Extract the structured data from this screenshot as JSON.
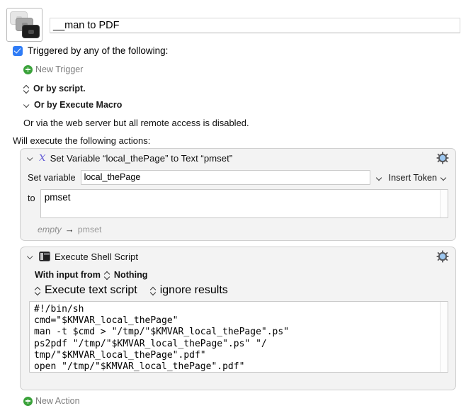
{
  "header": {
    "icon_name": "macro-stack-icon",
    "macro_title": "__man to PDF"
  },
  "triggers": {
    "checkbox_checked": true,
    "label": "Triggered by any of the following:",
    "new_trigger_label": "New Trigger",
    "or_by_script_label": "Or by script.",
    "or_by_execute_macro_label": "Or by Execute Macro",
    "web_server_note": "Or via the web server but all remote access is disabled."
  },
  "actions_intro": "Will execute the following actions:",
  "actions": [
    {
      "title": "Set Variable “local_thePage” to Text “pmset”",
      "icon_name": "variable-x-icon",
      "set_variable_label": "Set variable",
      "variable_name": "local_thePage",
      "insert_token_label": "Insert Token",
      "to_label": "to",
      "to_value": "pmset",
      "result_from": "empty",
      "result_arrow": "→",
      "result_to": "pmset"
    },
    {
      "title": "Execute Shell Script",
      "icon_name": "terminal-icon",
      "with_input_from_label": "With input from",
      "input_source": "Nothing",
      "execute_mode": "Execute text script",
      "results_mode": "ignore results",
      "script": "#!/bin/sh\ncmd=\"$KMVAR_local_thePage\"\nman -t $cmd > \"/tmp/\"$KMVAR_local_thePage\".ps\"\nps2pdf \"/tmp/\"$KMVAR_local_thePage\".ps\" \"/\ntmp/\"$KMVAR_local_thePage\".pdf\"\nopen \"/tmp/\"$KMVAR_local_thePage\".pdf\""
    }
  ],
  "new_action_label": "New Action",
  "colors": {
    "checkbox_blue": "#2f7cf6",
    "plus_green": "#3aa23a",
    "variable_purple": "#6a63d8",
    "gear_blue": "#9cc7f0",
    "panel_bg": "#f3f3f3"
  }
}
